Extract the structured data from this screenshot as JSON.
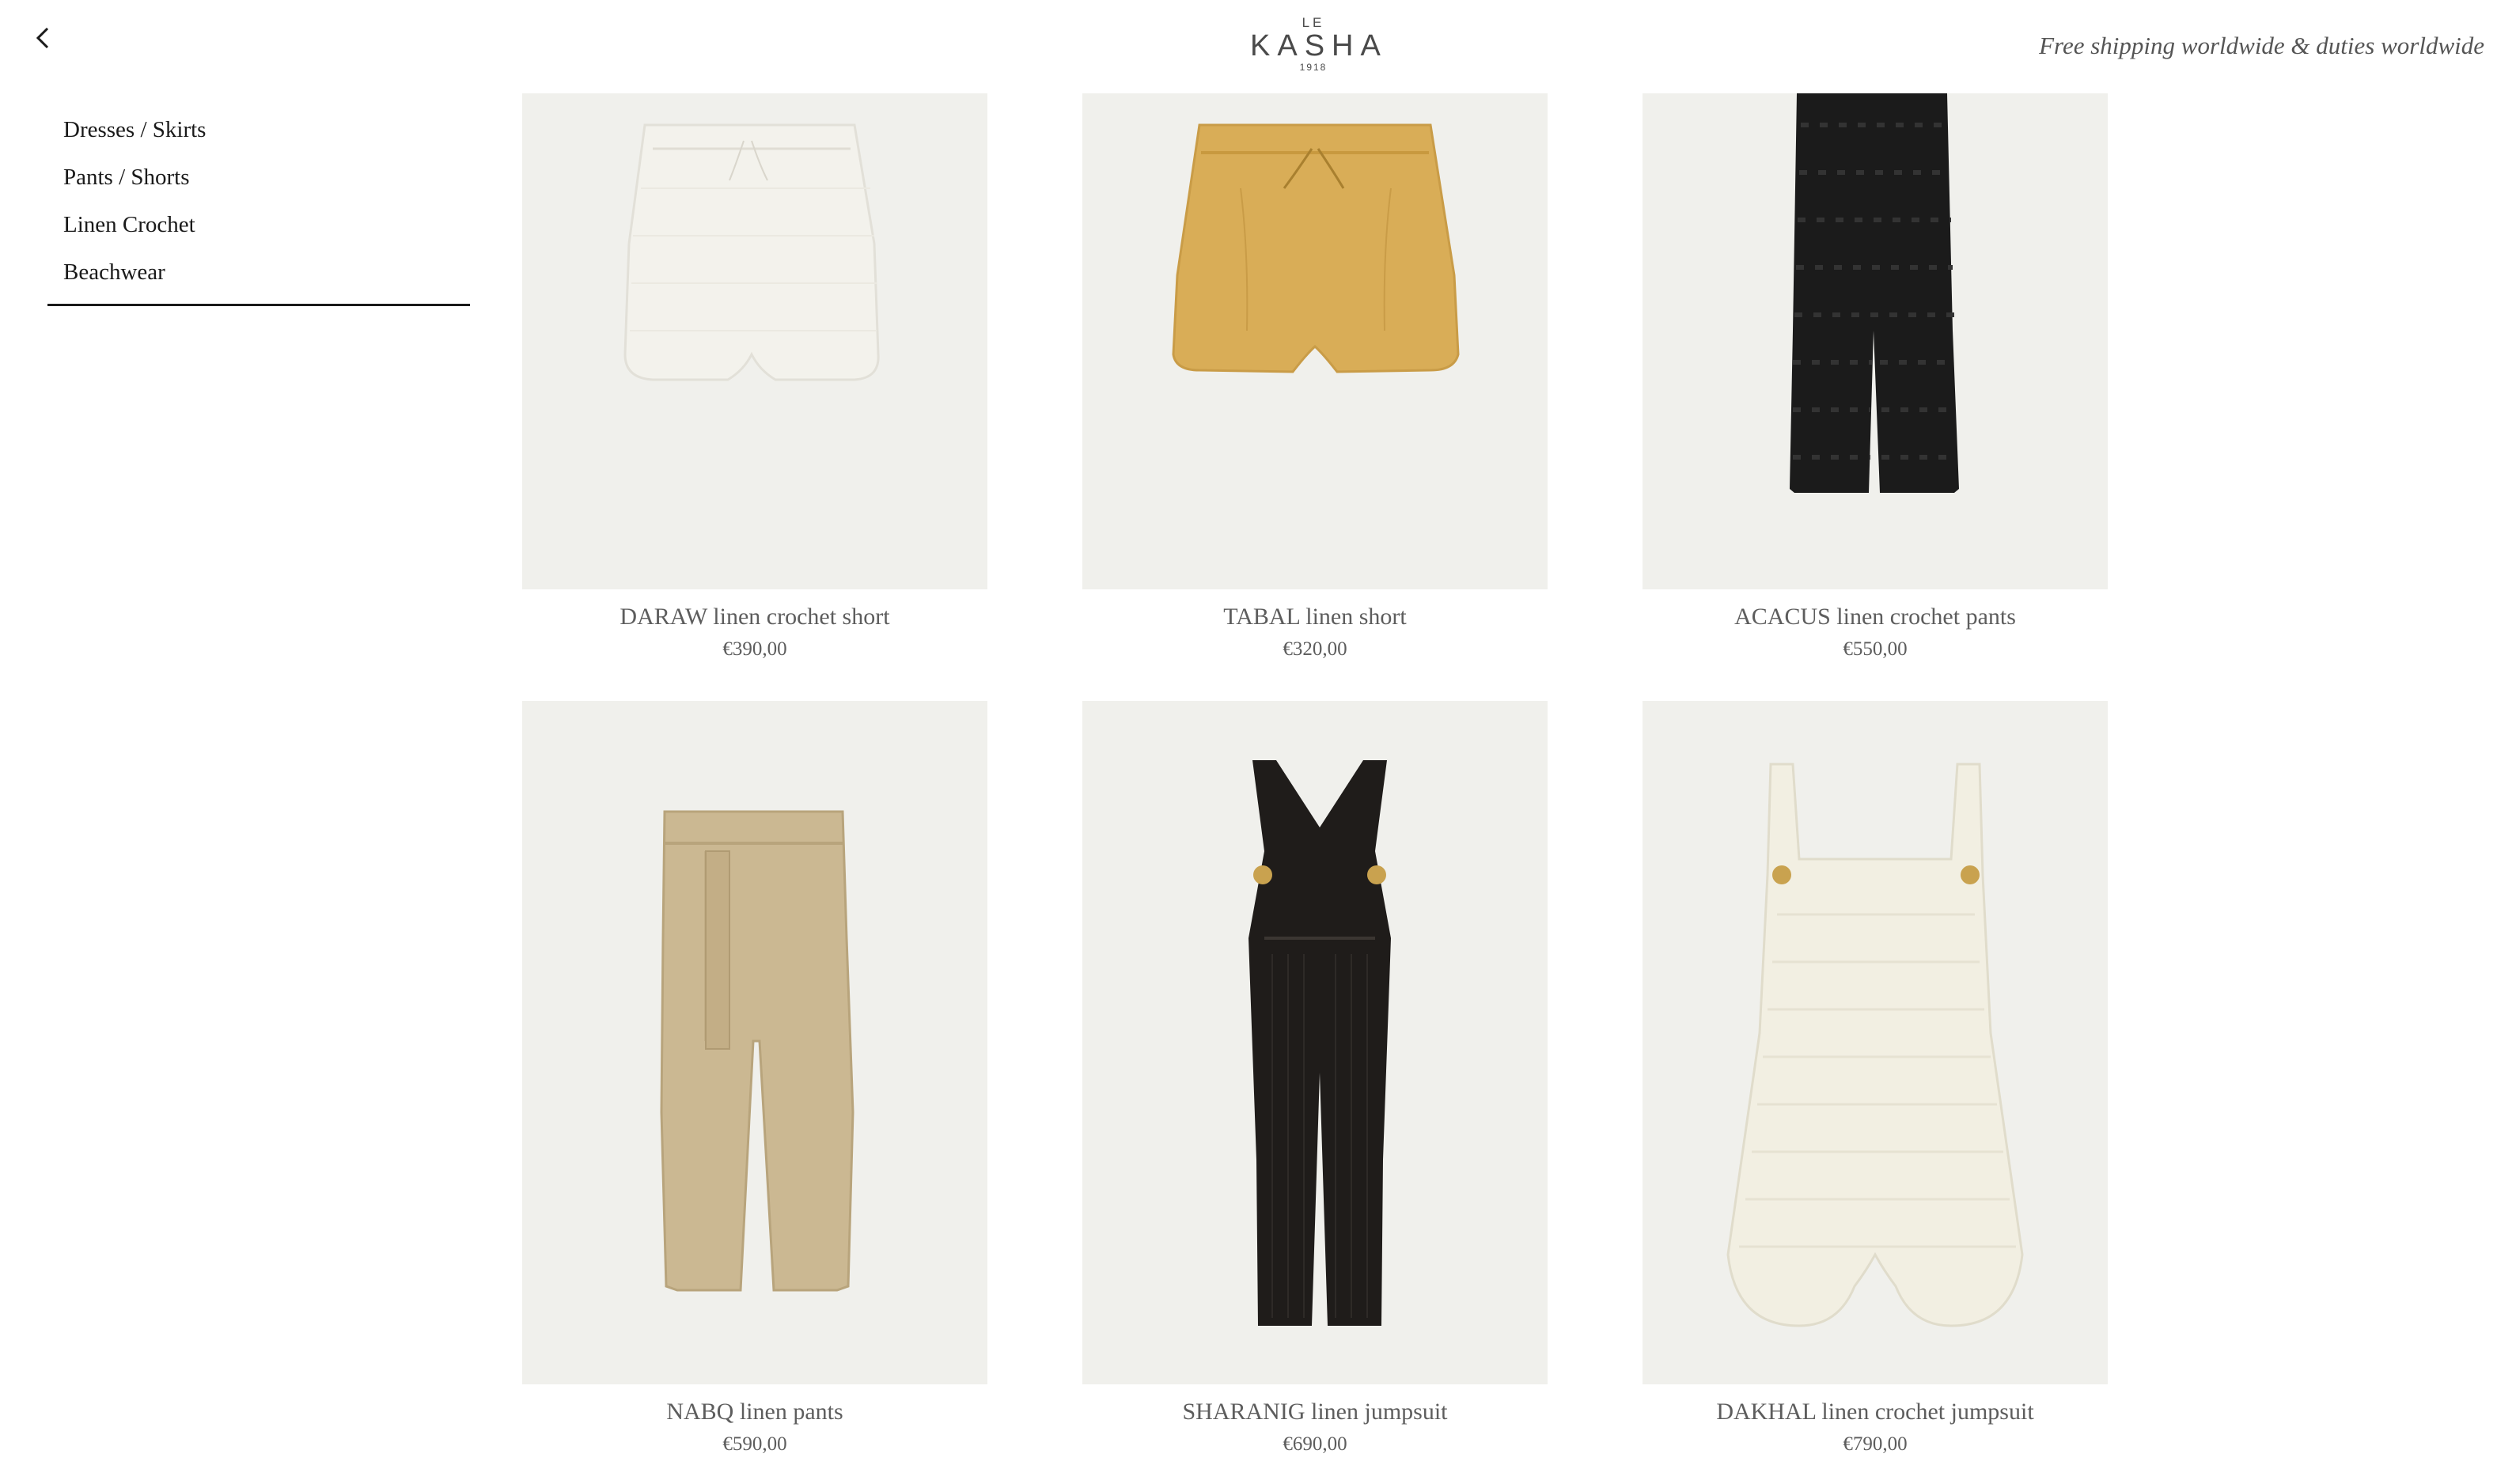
{
  "header": {
    "back_label": "Back",
    "logo_top": "LE",
    "logo_name": "KASHA",
    "logo_year": "1918",
    "shipping_text": "Free shipping worldwide & duties worldwide"
  },
  "sidebar": {
    "items": [
      {
        "label": "Dresses / Skirts"
      },
      {
        "label": "Pants / Shorts"
      },
      {
        "label": "Linen Crochet"
      },
      {
        "label": "Beachwear"
      }
    ]
  },
  "products": [
    {
      "name": "DARAW linen crochet short",
      "price": "€390,00",
      "color": "#f3f2ec"
    },
    {
      "name": "TABAL linen short",
      "price": "€320,00",
      "color": "#d9ad57"
    },
    {
      "name": "ACACUS linen crochet pants",
      "price": "€550,00",
      "color": "#1b1b1b"
    },
    {
      "name": "NABQ linen pants",
      "price": "€590,00",
      "color": "#cbb892"
    },
    {
      "name": "SHARANIG linen jumpsuit",
      "price": "€690,00",
      "color": "#1f1c1a"
    },
    {
      "name": "DAKHAL linen crochet jumpsuit",
      "price": "€790,00",
      "color": "#f2efe2"
    }
  ],
  "colors": {
    "background": "#ffffff",
    "image_background": "#f0f0ec",
    "text": "#5d5d5d"
  }
}
